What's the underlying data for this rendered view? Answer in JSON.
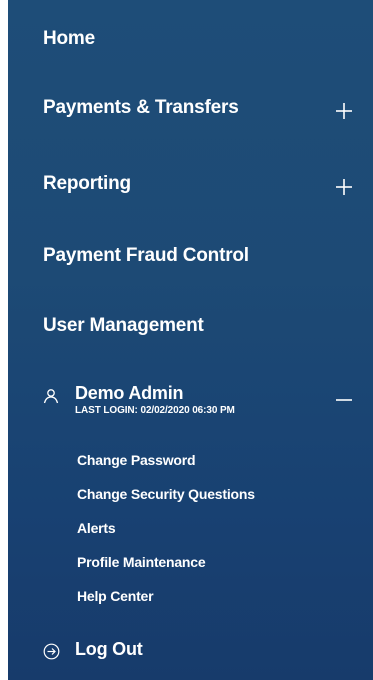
{
  "colors": {
    "panel_background": "#1d4a75",
    "text": "#ffffff"
  },
  "nav": {
    "home": "Home",
    "payments_transfers": "Payments & Transfers",
    "reporting": "Reporting",
    "payment_fraud_control": "Payment Fraud Control",
    "user_management": "User Management"
  },
  "user": {
    "name": "Demo Admin",
    "last_login_label": "LAST LOGIN:",
    "last_login_value": "02/02/2020 06:30 PM",
    "icon": "user-icon",
    "expanded": true
  },
  "submenu": [
    "Change Password",
    "Change Security Questions",
    "Alerts",
    "Profile Maintenance",
    "Help Center"
  ],
  "logout": {
    "label": "Log Out",
    "icon": "logout-arrow-icon"
  },
  "icons": {
    "expand": "plus-icon",
    "collapse": "minus-icon"
  }
}
